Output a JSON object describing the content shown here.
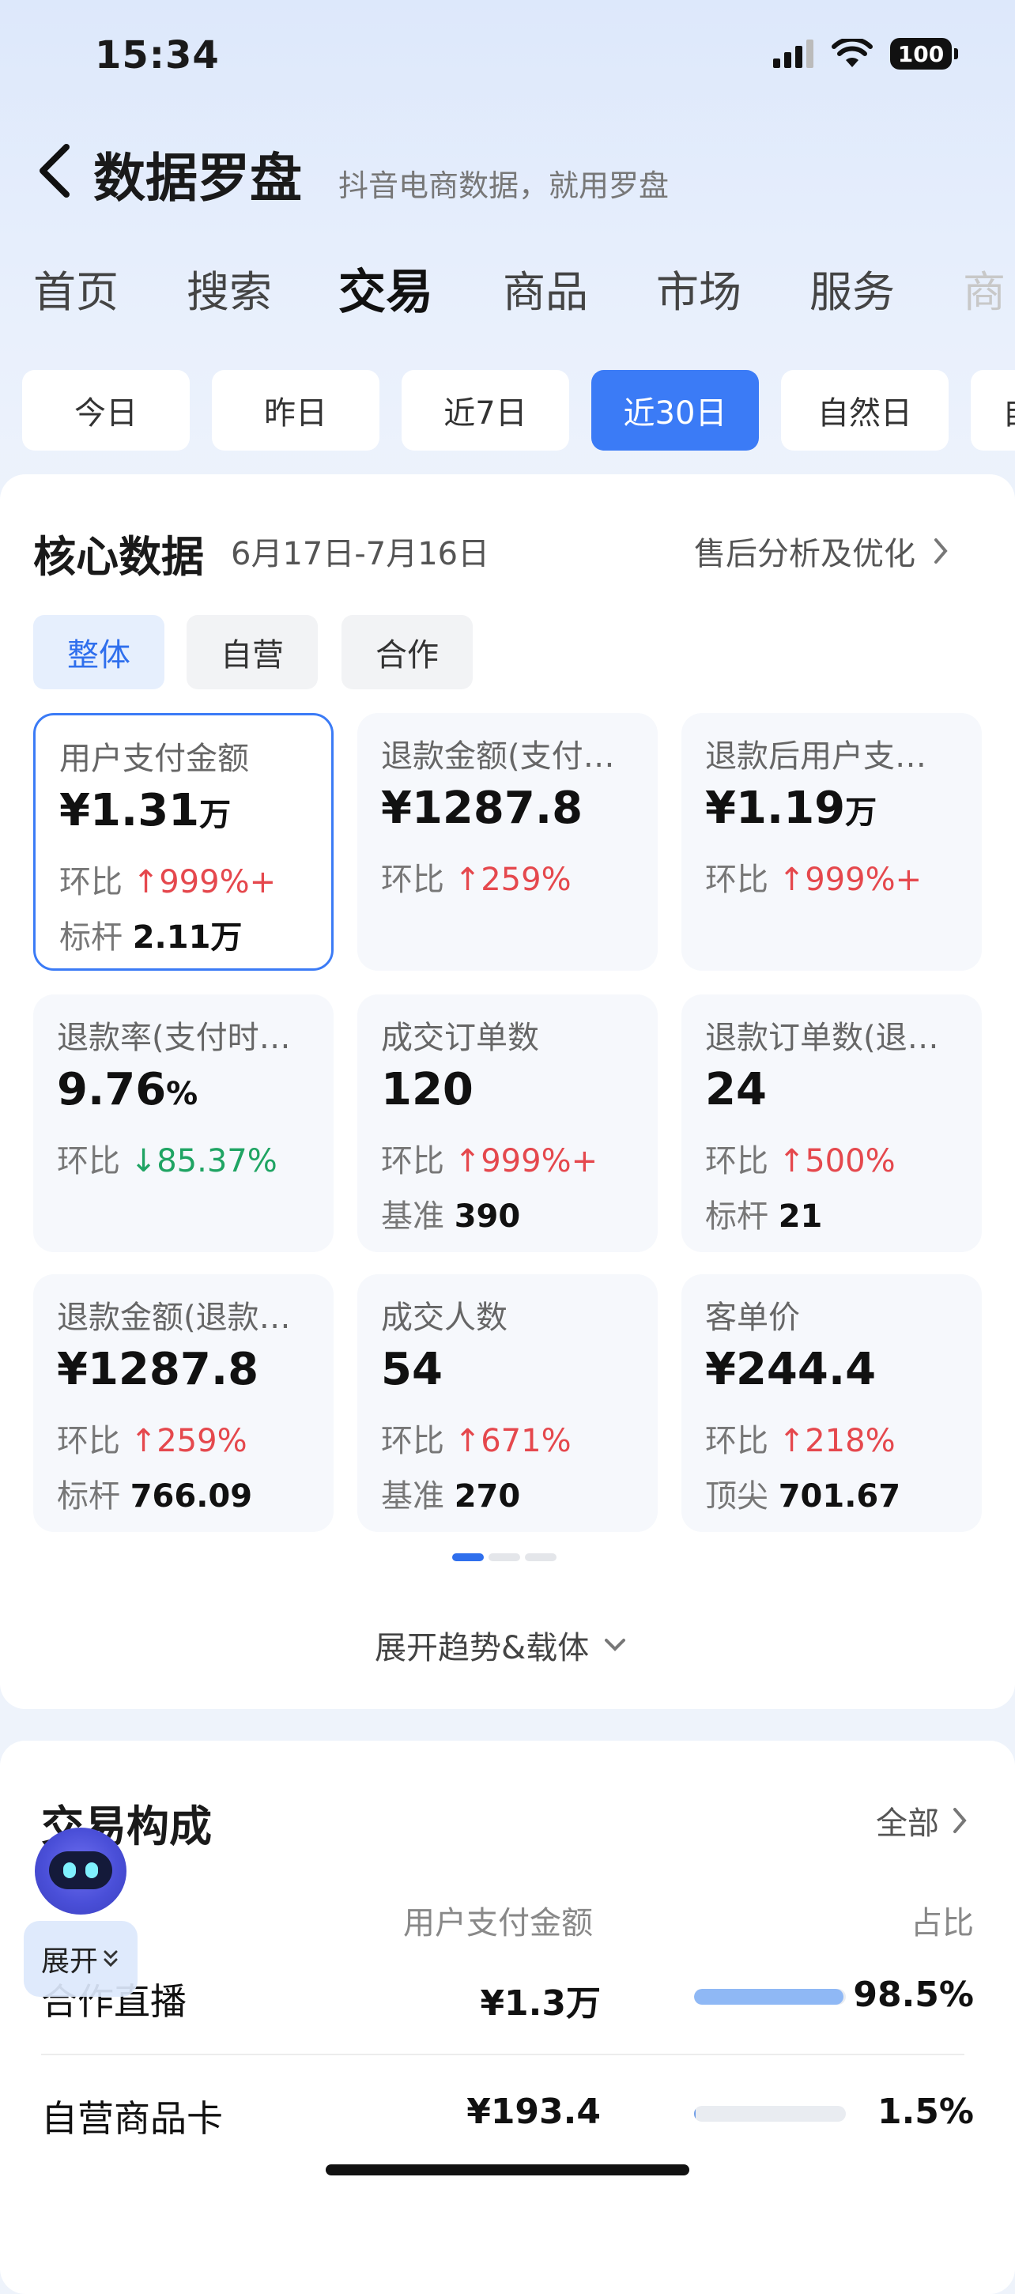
{
  "status": {
    "time": "15:34",
    "battery": "100"
  },
  "header": {
    "title": "数据罗盘",
    "subtitle": "抖音电商数据，就用罗盘"
  },
  "main_tabs": [
    "首页",
    "搜索",
    "交易",
    "商品",
    "市场",
    "服务",
    "商"
  ],
  "active_tab": "交易",
  "date_filters": [
    "今日",
    "昨日",
    "近7日",
    "近30日",
    "自然日",
    "自"
  ],
  "active_date": "近30日",
  "core": {
    "title": "核心数据",
    "date_range": "6月17日-7月16日",
    "after_sale_link": "售后分析及优化",
    "segments": [
      "整体",
      "自营",
      "合作"
    ],
    "active_segment": "整体",
    "compare_label": "环比",
    "metrics": [
      {
        "label": "用户支付金额",
        "value": "¥1.31",
        "unit": "万",
        "change_dir": "up",
        "change": "999%+",
        "bench_label": "标杆",
        "bench_value": "2.11万"
      },
      {
        "label": "退款金额(支付…",
        "value": "¥1287.8",
        "unit": "",
        "change_dir": "up",
        "change": "259%",
        "bench_label": "",
        "bench_value": ""
      },
      {
        "label": "退款后用户支…",
        "value": "¥1.19",
        "unit": "万",
        "change_dir": "up",
        "change": "999%+",
        "bench_label": "",
        "bench_value": ""
      },
      {
        "label": "退款率(支付时…",
        "value": "9.76",
        "unit": "%",
        "change_dir": "down",
        "change": "85.37%",
        "bench_label": "",
        "bench_value": ""
      },
      {
        "label": "成交订单数",
        "value": "120",
        "unit": "",
        "change_dir": "up",
        "change": "999%+",
        "bench_label": "基准",
        "bench_value": "390"
      },
      {
        "label": "退款订单数(退…",
        "value": "24",
        "unit": "",
        "change_dir": "up",
        "change": "500%",
        "bench_label": "标杆",
        "bench_value": "21"
      },
      {
        "label": "退款金额(退款…",
        "value": "¥1287.8",
        "unit": "",
        "change_dir": "up",
        "change": "259%",
        "bench_label": "标杆",
        "bench_value": "766.09"
      },
      {
        "label": "成交人数",
        "value": "54",
        "unit": "",
        "change_dir": "up",
        "change": "671%",
        "bench_label": "基准",
        "bench_value": "270"
      },
      {
        "label": "客单价",
        "value": "¥244.4",
        "unit": "",
        "change_dir": "up",
        "change": "218%",
        "bench_label": "顶尖",
        "bench_value": "701.67"
      }
    ],
    "expand_label": "展开趋势&载体"
  },
  "composition": {
    "title": "交易构成",
    "all_link": "全部",
    "col_pay": "用户支付金额",
    "col_share": "占比",
    "rows": [
      {
        "name": "合作直播",
        "amount": "¥1.3万",
        "share": "98.5%",
        "share_value": 98.5
      },
      {
        "name": "自营商品卡",
        "amount": "¥193.4",
        "share": "1.5%",
        "share_value": 1.5
      }
    ]
  },
  "assistant": {
    "expand_label": "展开"
  },
  "colors": {
    "accent": "#3b7bf6",
    "up": "#e5484d",
    "down": "#1fa463"
  }
}
